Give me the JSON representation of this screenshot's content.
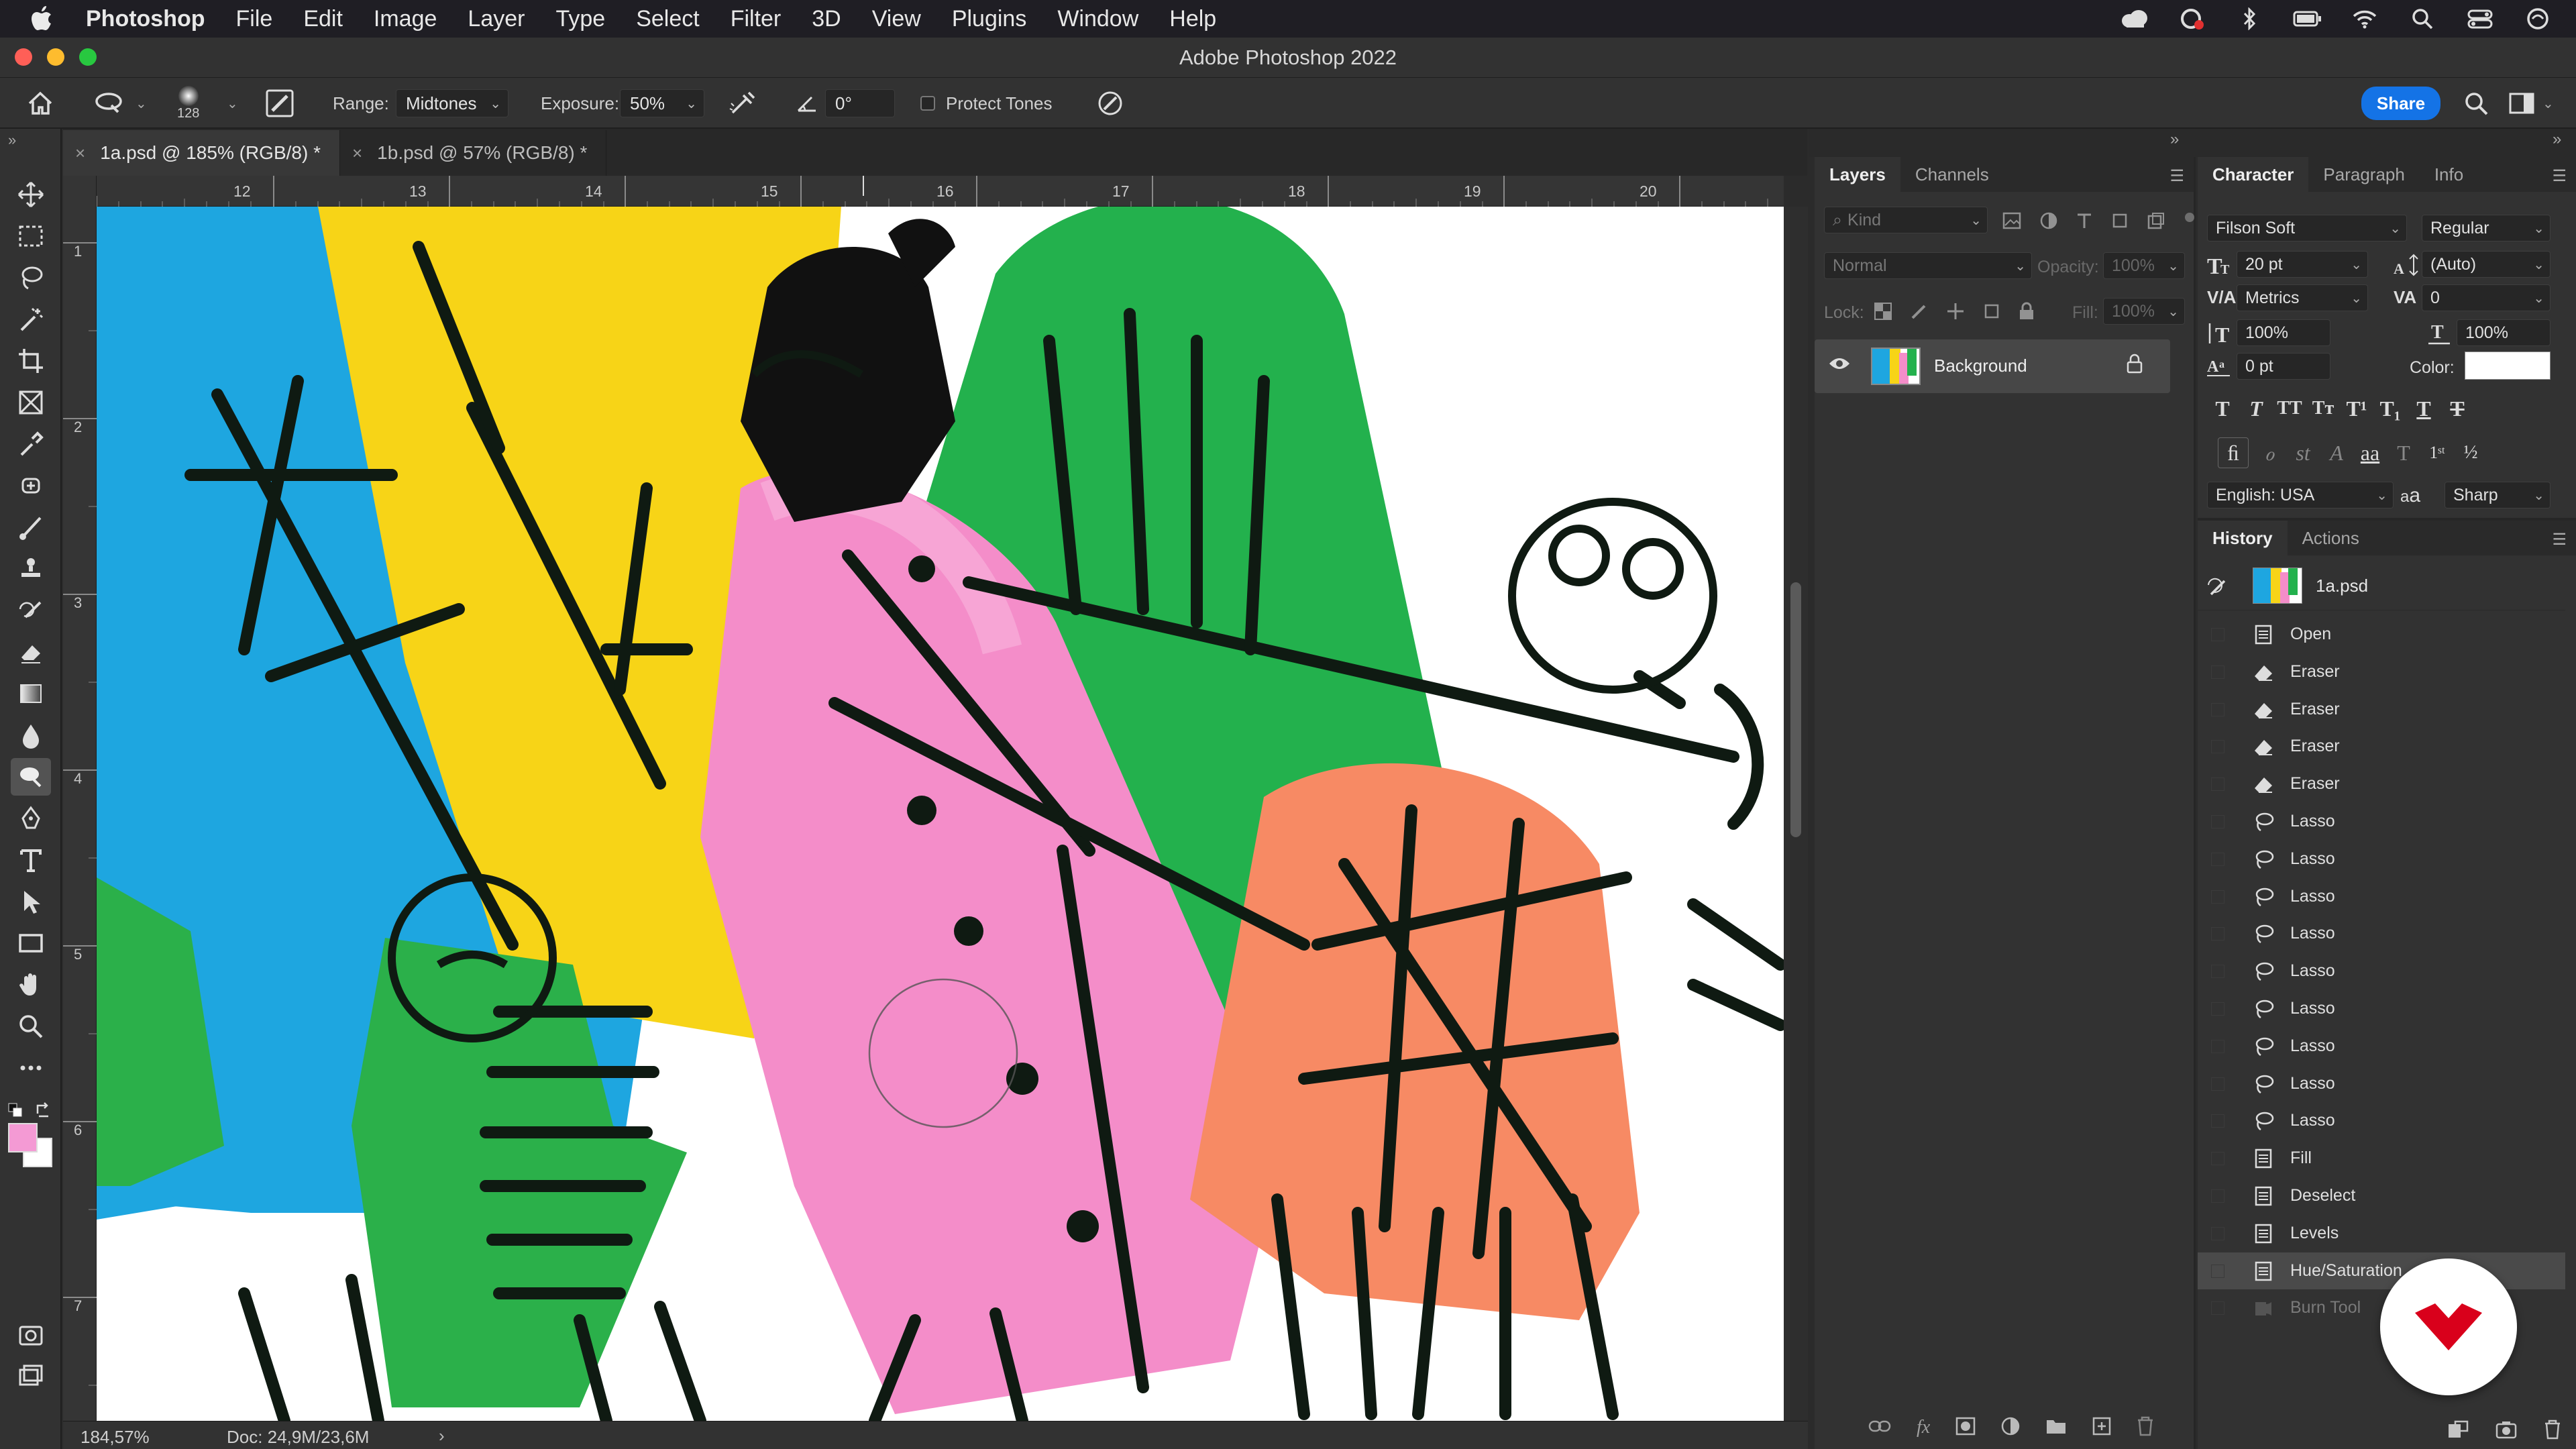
{
  "menubar": {
    "items": [
      "Photoshop",
      "File",
      "Edit",
      "Image",
      "Layer",
      "Type",
      "Select",
      "Filter",
      "3D",
      "View",
      "Plugins",
      "Window",
      "Help"
    ],
    "right_icons": [
      "creative-cloud-icon",
      "cc-sync-icon",
      "bluetooth-icon",
      "battery-icon",
      "wifi-icon",
      "spotlight-icon",
      "control-center-icon",
      "siri-icon"
    ]
  },
  "window": {
    "title": "Adobe Photoshop 2022"
  },
  "options": {
    "brush_size": "128",
    "range_label": "Range:",
    "range_value": "Midtones",
    "exposure_label": "Exposure:",
    "exposure_value": "50%",
    "angle_value": "0°",
    "protect_tones": "Protect Tones",
    "share": "Share"
  },
  "tabs": [
    {
      "label": "1a.psd @ 185% (RGB/8) *",
      "active": true
    },
    {
      "label": "1b.psd @ 57% (RGB/8) *",
      "active": false
    }
  ],
  "ruler": {
    "top": [
      "12",
      "13",
      "14",
      "15",
      "16",
      "17",
      "18",
      "19",
      "20"
    ],
    "left": [
      "1",
      "2",
      "3",
      "4",
      "5",
      "6",
      "7"
    ]
  },
  "status": {
    "zoom": "184,57%",
    "doc": "Doc: 24,9M/23,6M"
  },
  "layers": {
    "tabs": [
      "Layers",
      "Channels"
    ],
    "kind": "Kind",
    "blend": "Normal",
    "opacity_label": "Opacity:",
    "opacity_value": "100%",
    "lock_label": "Lock:",
    "fill_label": "Fill:",
    "fill_value": "100%",
    "layer_name": "Background"
  },
  "character": {
    "tabs": [
      "Character",
      "Paragraph",
      "Info"
    ],
    "font": "Filson Soft",
    "style": "Regular",
    "size": "20 pt",
    "leading": "(Auto)",
    "kerning": "Metrics",
    "tracking": "0",
    "vscale": "100%",
    "hscale": "100%",
    "baseline": "0 pt",
    "color_label": "Color:",
    "language": "English: USA",
    "antialias": "Sharp",
    "aa_label": "a",
    "color_value": "#ffffff"
  },
  "history": {
    "tabs": [
      "History",
      "Actions"
    ],
    "snapshot": "1a.psd",
    "items": [
      {
        "label": "Open",
        "icon": "document-icon"
      },
      {
        "label": "Eraser",
        "icon": "eraser-icon"
      },
      {
        "label": "Eraser",
        "icon": "eraser-icon"
      },
      {
        "label": "Eraser",
        "icon": "eraser-icon"
      },
      {
        "label": "Eraser",
        "icon": "eraser-icon"
      },
      {
        "label": "Lasso",
        "icon": "lasso-icon"
      },
      {
        "label": "Lasso",
        "icon": "lasso-icon"
      },
      {
        "label": "Lasso",
        "icon": "lasso-icon"
      },
      {
        "label": "Lasso",
        "icon": "lasso-icon"
      },
      {
        "label": "Lasso",
        "icon": "lasso-icon"
      },
      {
        "label": "Lasso",
        "icon": "lasso-icon"
      },
      {
        "label": "Lasso",
        "icon": "lasso-icon"
      },
      {
        "label": "Lasso",
        "icon": "lasso-icon"
      },
      {
        "label": "Lasso",
        "icon": "lasso-icon"
      },
      {
        "label": "Fill",
        "icon": "document-icon"
      },
      {
        "label": "Deselect",
        "icon": "document-icon"
      },
      {
        "label": "Levels",
        "icon": "document-icon"
      },
      {
        "label": "Hue/Saturation",
        "icon": "document-icon"
      },
      {
        "label": "Burn Tool",
        "icon": "burn-icon"
      }
    ]
  },
  "colors": {
    "foreground": "#f49ad4",
    "background": "#ffffff",
    "accent": "#1473e6",
    "logo": "#d9001b"
  }
}
